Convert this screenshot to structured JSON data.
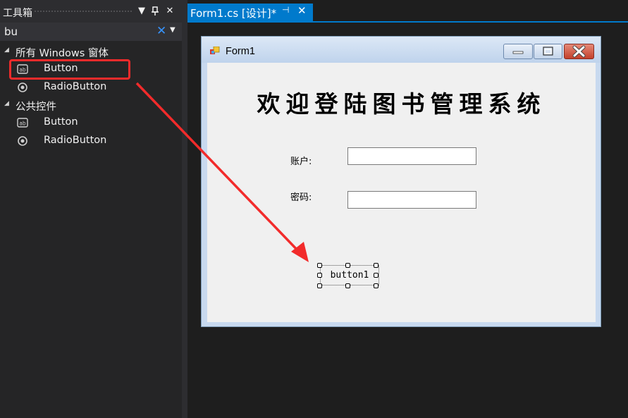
{
  "toolbox": {
    "title": "工具箱",
    "search_value": "bu",
    "groups": [
      {
        "label": "所有 Windows 窗体",
        "items": [
          {
            "label": "Button",
            "icon": "button-control-icon"
          },
          {
            "label": "RadioButton",
            "icon": "radio-button-icon"
          }
        ]
      },
      {
        "label": "公共控件",
        "items": [
          {
            "label": "Button",
            "icon": "button-control-icon"
          },
          {
            "label": "RadioButton",
            "icon": "radio-button-icon"
          }
        ]
      }
    ]
  },
  "document": {
    "tab_label": "Form1.cs [设计]*"
  },
  "form": {
    "title": "Form1",
    "heading": "欢迎登陆图书管理系统",
    "account_label": "账户:",
    "password_label": "密码:",
    "button_text": "button1"
  },
  "colors": {
    "accent": "#007acc",
    "highlight": "#f22b2b",
    "panel_bg": "#252526",
    "editor_bg": "#1e1e1e"
  }
}
